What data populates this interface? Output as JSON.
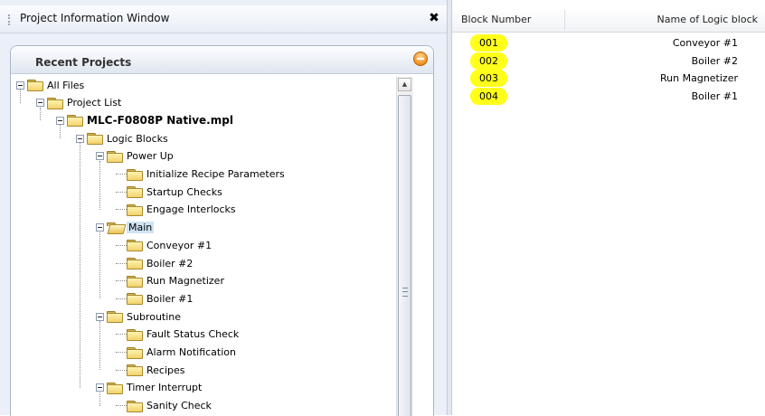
{
  "window": {
    "title": "Project Information Window",
    "close_glyph": "✖"
  },
  "recent_projects": {
    "title": "Recent Projects",
    "tree": [
      {
        "label": "All Files",
        "level": 0,
        "expanded": true
      },
      {
        "label": "Project List",
        "level": 1,
        "expanded": true
      },
      {
        "label": "MLC-F0808P Native.mpl",
        "level": 2,
        "expanded": true,
        "bold": true
      },
      {
        "label": "Logic Blocks",
        "level": 3,
        "expanded": true
      },
      {
        "label": "Power Up",
        "level": 4,
        "expanded": true
      },
      {
        "label": "Initialize Recipe Parameters",
        "level": 5
      },
      {
        "label": "Startup Checks",
        "level": 5
      },
      {
        "label": "Engage Interlocks",
        "level": 5
      },
      {
        "label": "Main",
        "level": 4,
        "expanded": true,
        "selected": true,
        "open": true
      },
      {
        "label": "Conveyor #1",
        "level": 5
      },
      {
        "label": "Boiler #2",
        "level": 5
      },
      {
        "label": "Run Magnetizer",
        "level": 5
      },
      {
        "label": "Boiler #1",
        "level": 5
      },
      {
        "label": "Subroutine",
        "level": 4,
        "expanded": true
      },
      {
        "label": "Fault Status Check",
        "level": 5
      },
      {
        "label": "Alarm Notification",
        "level": 5
      },
      {
        "label": "Recipes",
        "level": 5
      },
      {
        "label": "Timer Interrupt",
        "level": 4,
        "expanded": true
      },
      {
        "label": "Sanity Check",
        "level": 5
      }
    ]
  },
  "logic_table": {
    "columns": [
      "Block Number",
      "Name of Logic block"
    ],
    "rows": [
      {
        "number": "001",
        "name": "Conveyor #1"
      },
      {
        "number": "002",
        "name": "Boiler #2"
      },
      {
        "number": "003",
        "name": "Run Magnetizer"
      },
      {
        "number": "004",
        "name": "Boiler #1"
      }
    ],
    "highlight_color": "#ffff1a"
  },
  "colors": {
    "selection": "#cfe3f2",
    "folder": "#f2d26b",
    "accent_orange": "#f0901e"
  }
}
